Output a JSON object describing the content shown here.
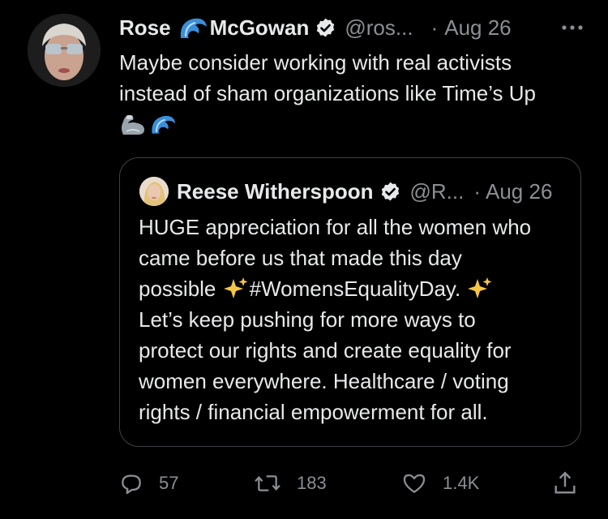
{
  "tweet": {
    "author_first": "Rose",
    "author_last": "McGowan",
    "handle": "@ros...",
    "separator": "·",
    "date": "Aug 26",
    "lines": [
      "Maybe consider working with real activists",
      "instead of sham organizations like Time’s Up"
    ],
    "emojis": [
      "flexed-biceps-icon",
      "water-wave-icon"
    ]
  },
  "quote": {
    "author": "Reese Witherspoon",
    "handle": "@R...",
    "separator": "·",
    "date": "Aug 26",
    "lines": {
      "l1": "HUGE appreciation for all the women who",
      "l2": "came before us that made this day",
      "l3a": "possible ",
      "l3b": "#WomensEqualityDay. ",
      "l4": "Let’s keep pushing for more ways to",
      "l5": "protect our rights and create equality for",
      "l6": "women everywhere. Healthcare / voting",
      "l7": "rights / financial empowerment for all."
    }
  },
  "actions": {
    "replies": "57",
    "retweets": "183",
    "likes": "1.4K"
  },
  "colors": {
    "background": "#000000",
    "text": "#e7e9ea",
    "muted": "#8b8f94",
    "border": "#3e4144",
    "wave_blue": "#3b8fd9"
  }
}
